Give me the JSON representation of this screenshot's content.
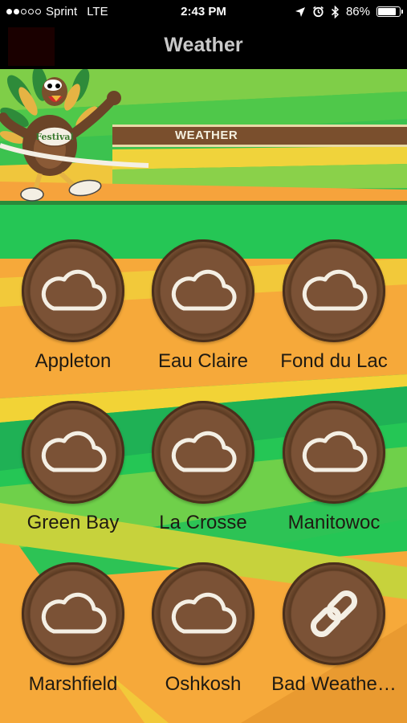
{
  "status_bar": {
    "carrier": "Sprint",
    "network": "LTE",
    "time": "2:43 PM",
    "battery": "86%",
    "battery_level": 0.86,
    "signal_bars_filled": 2,
    "signal_bars_total": 5
  },
  "nav": {
    "title": "Weather"
  },
  "banner": {
    "label": "WEATHER",
    "logo_text": "Festival"
  },
  "colors": {
    "green": "#25c655",
    "lime": "#7ed04a",
    "yellow": "#f2d336",
    "orange": "#f6a93a",
    "brown": "#6b4428",
    "cream": "#f4efe4"
  },
  "tiles": [
    {
      "label": "Appleton",
      "icon": "cloud-icon"
    },
    {
      "label": "Eau Claire",
      "icon": "cloud-icon"
    },
    {
      "label": "Fond du Lac",
      "icon": "cloud-icon"
    },
    {
      "label": "Green Bay",
      "icon": "cloud-icon"
    },
    {
      "label": "La Crosse",
      "icon": "cloud-icon"
    },
    {
      "label": "Manitowoc",
      "icon": "cloud-icon"
    },
    {
      "label": "Marshfield",
      "icon": "cloud-icon"
    },
    {
      "label": "Oshkosh",
      "icon": "cloud-icon"
    },
    {
      "label": "Bad Weathe…",
      "icon": "link-icon"
    }
  ]
}
